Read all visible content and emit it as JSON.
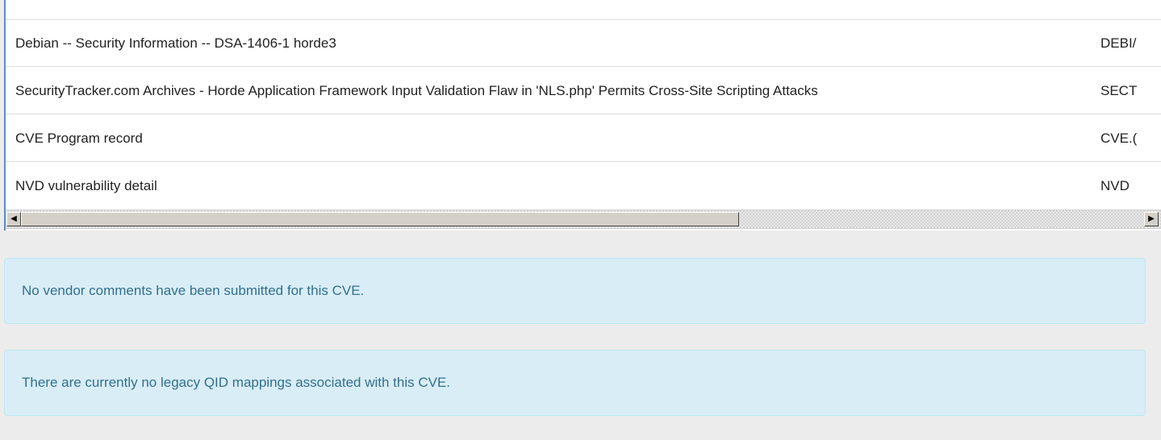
{
  "references": {
    "rows": [
      {
        "title": "Debian -- Security Information -- DSA-1406-1 horde3",
        "source": "DEBI/"
      },
      {
        "title": "SecurityTracker.com Archives - Horde Application Framework Input Validation Flaw in 'NLS.php' Permits Cross-Site Scripting Attacks",
        "source": "SECT"
      },
      {
        "title": "CVE Program record",
        "source": "CVE.("
      },
      {
        "title": "NVD vulnerability detail",
        "source": "NVD"
      }
    ]
  },
  "scrollbar": {
    "left_arrow": "◀",
    "right_arrow": "▶",
    "thumb_fraction": 0.63
  },
  "vendor_comments": {
    "message": "No vendor comments have been submitted for this CVE."
  },
  "qid_mappings": {
    "message": "There are currently no legacy QID mappings associated with this CVE."
  },
  "colors": {
    "panel_border": "#5b8fc7",
    "alert_bg": "#d9edf7",
    "alert_text": "#31708f"
  }
}
